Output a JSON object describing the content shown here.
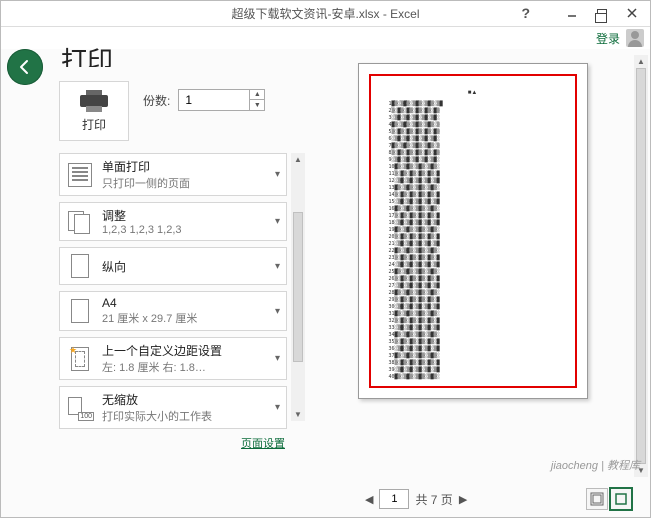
{
  "window": {
    "title": "超级下载软文资讯-安卓.xlsx - Excel",
    "help": "?",
    "signin": "登录"
  },
  "page_heading": "打印",
  "print_button_label": "打印",
  "copies": {
    "label": "份数:",
    "value": "1"
  },
  "settings": {
    "duplex": {
      "line1": "单面打印",
      "line2": "只打印一侧的页面"
    },
    "collate": {
      "line1": "调整",
      "line2": "1,2,3    1,2,3    1,2,3"
    },
    "orientation": {
      "line1": "纵向",
      "line2": ""
    },
    "papersize": {
      "line1": "A4",
      "line2": "21 厘米 x 29.7 厘米"
    },
    "margins": {
      "line1": "上一个自定义边距设置",
      "line2": "左: 1.8 厘米    右: 1.8…"
    },
    "scaling": {
      "line1": "无缩放",
      "line2": "打印实际大小的工作表"
    }
  },
  "page_setup_link": "页面设置",
  "pager": {
    "current": "1",
    "of_label": "共 7 页"
  },
  "watermark": "jiaocheng | 教程库"
}
